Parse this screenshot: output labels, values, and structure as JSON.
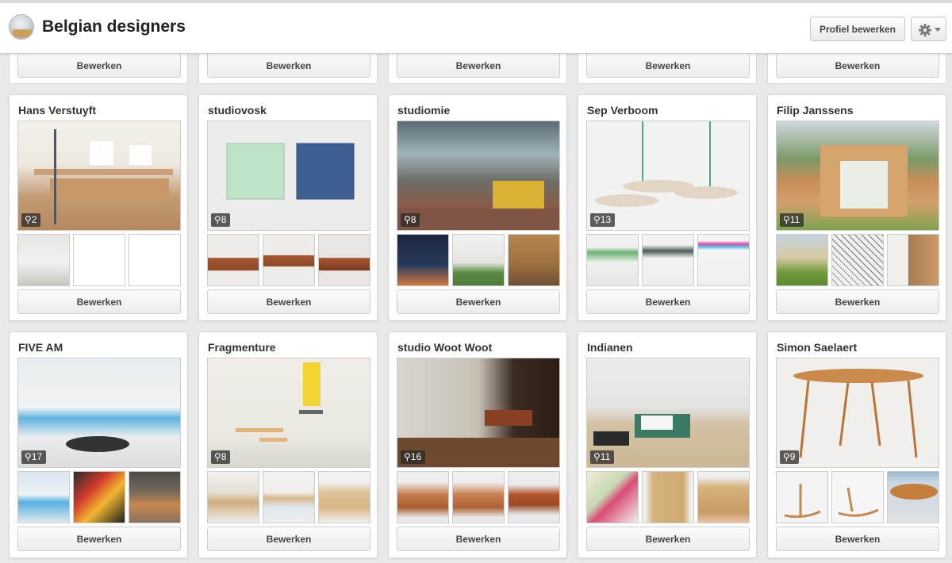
{
  "header": {
    "title": "Belgian designers",
    "profile_button": "Profiel bewerken",
    "settings_icon": "gear-icon"
  },
  "edit_label": "Bewerken",
  "top_row_count": 5,
  "boards": [
    {
      "name": "Hans Verstuyft",
      "pins": "2"
    },
    {
      "name": "studiovosk",
      "pins": "8"
    },
    {
      "name": "studiomie",
      "pins": "8"
    },
    {
      "name": "Sep Verboom",
      "pins": "13"
    },
    {
      "name": "Filip Janssens",
      "pins": "11"
    },
    {
      "name": "FIVE AM",
      "pins": "17"
    },
    {
      "name": "Fragmenture",
      "pins": "8"
    },
    {
      "name": "studio Woot Woot",
      "pins": "16"
    },
    {
      "name": "Indianen",
      "pins": "11"
    },
    {
      "name": "Simon Saelaert",
      "pins": "9"
    }
  ]
}
